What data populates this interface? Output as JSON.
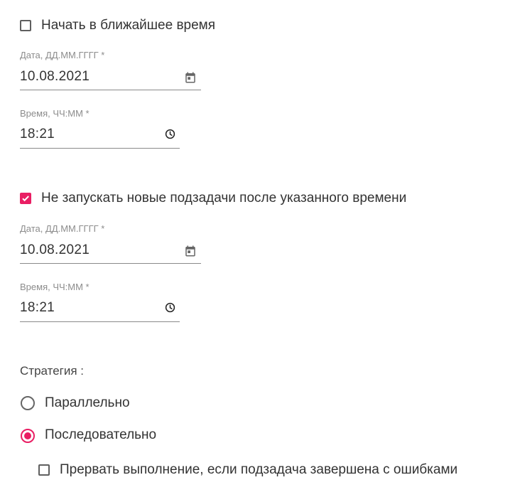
{
  "start_asap": {
    "label": "Начать в ближайшее время",
    "checked": false
  },
  "start_date": {
    "label": "Дата, ДД.ММ.ГГГГ *",
    "value": "10.08.2021",
    "icon": "calendar-icon"
  },
  "start_time": {
    "label": "Время, ЧЧ:ММ *",
    "value": "18:21",
    "icon": "clock-icon"
  },
  "no_new_subtasks": {
    "label": "Не запускать новые подзадачи после указанного времени",
    "checked": true
  },
  "end_date": {
    "label": "Дата, ДД.ММ.ГГГГ *",
    "value": "10.08.2021",
    "icon": "calendar-icon"
  },
  "end_time": {
    "label": "Время, ЧЧ:ММ *",
    "value": "18:21",
    "icon": "clock-icon"
  },
  "strategy": {
    "title": "Стратегия :",
    "options": [
      {
        "label": "Параллельно",
        "selected": false
      },
      {
        "label": "Последовательно",
        "selected": true
      }
    ]
  },
  "abort_on_error": {
    "label": "Прервать выполнение, если подзадача завершена с ошибками",
    "checked": false
  },
  "colors": {
    "accent": "#e91e63",
    "text": "#333333",
    "muted": "#8c8c8c"
  }
}
